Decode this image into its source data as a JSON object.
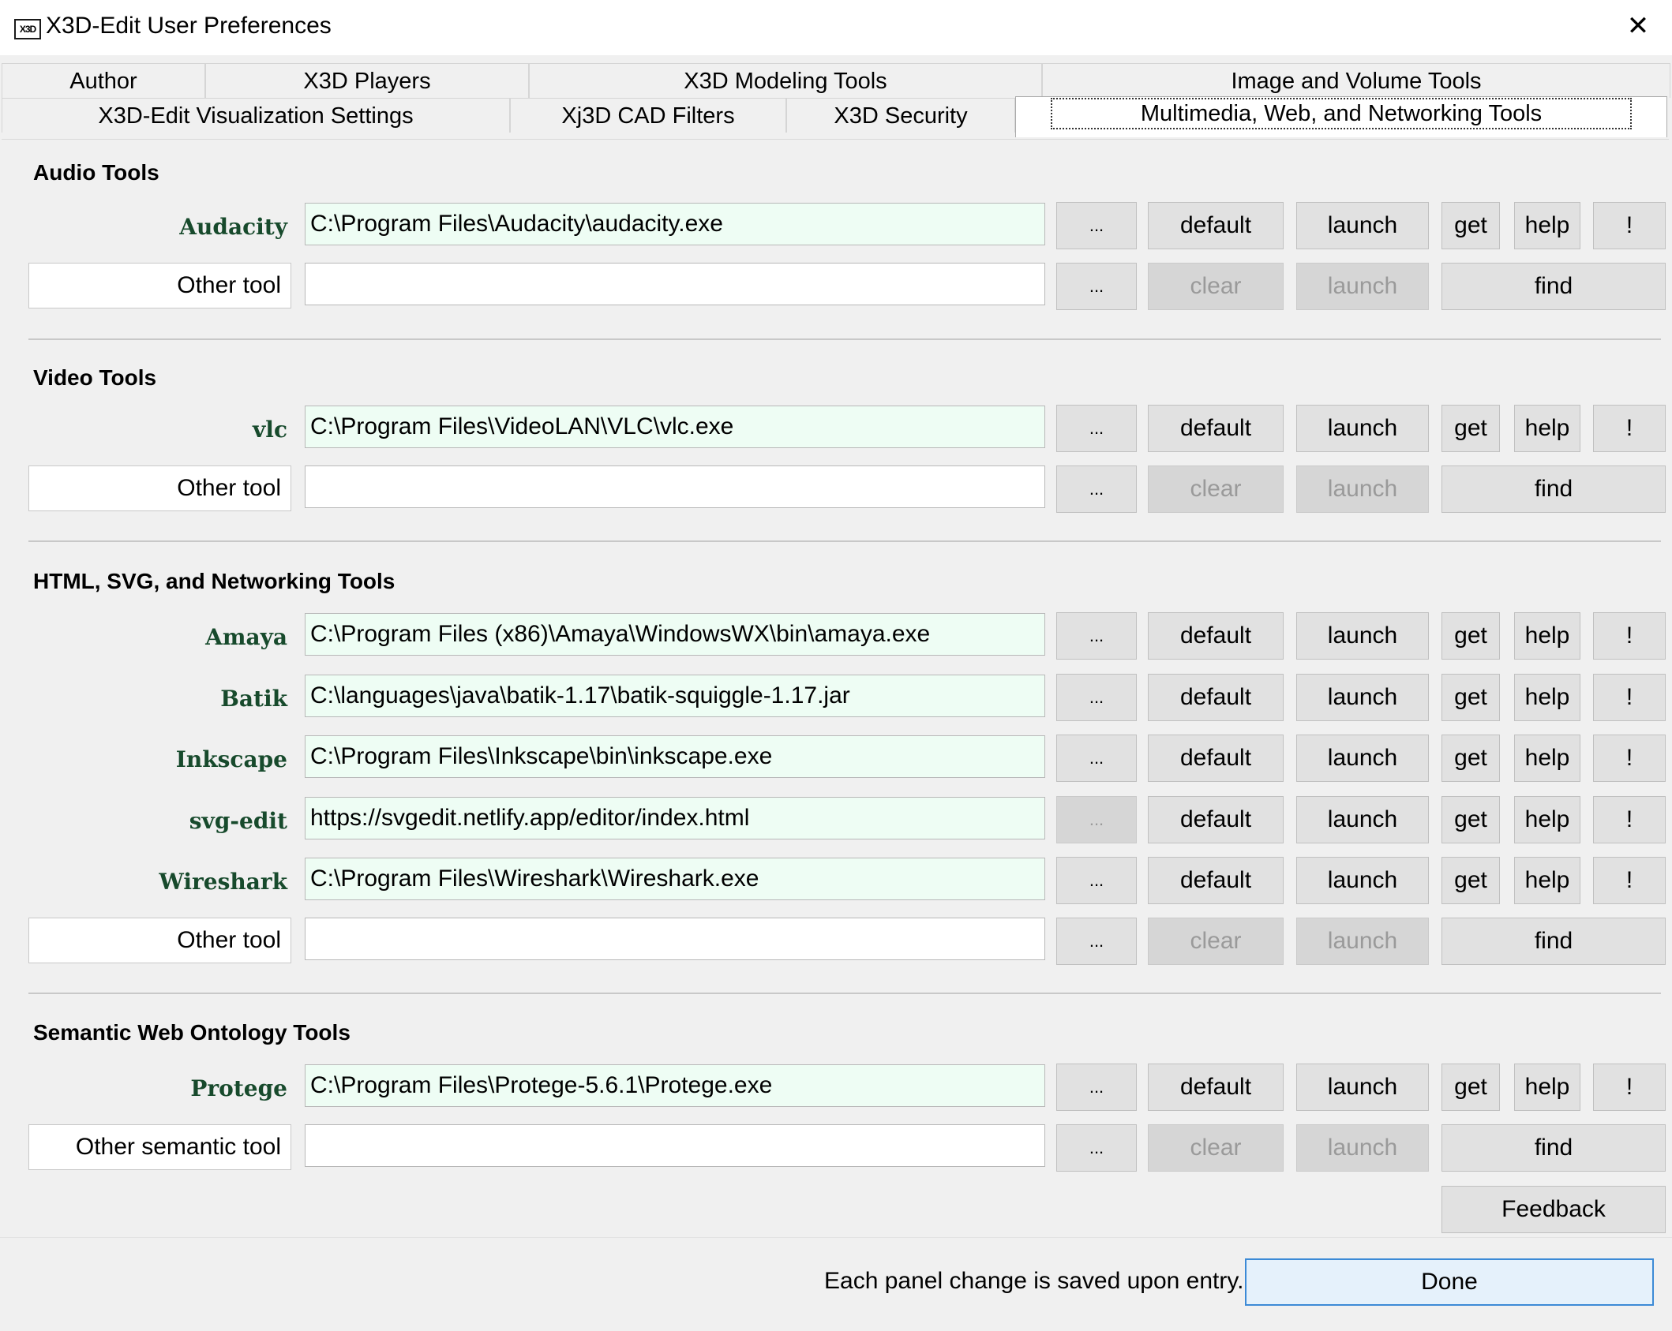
{
  "window": {
    "title": "X3D-Edit User Preferences",
    "icon_text": "X3D",
    "close_glyph": "✕"
  },
  "tabs": {
    "row1": [
      "Author",
      "X3D Players",
      "X3D Modeling Tools",
      "Image and Volume Tools"
    ],
    "row2": [
      "X3D-Edit Visualization Settings",
      "Xj3D CAD Filters",
      "X3D Security",
      "Multimedia, Web, and Networking Tools"
    ],
    "selected": "Multimedia, Web, and Networking Tools"
  },
  "buttons": {
    "browse": "...",
    "default": "default",
    "launch": "launch",
    "get": "get",
    "help": "help",
    "bang": "!",
    "clear": "clear",
    "find": "find",
    "feedback": "Feedback"
  },
  "sections": {
    "audio": {
      "title": "Audio Tools",
      "tools": [
        {
          "name": "Audacity",
          "path": "C:\\Program Files\\Audacity\\audacity.exe"
        }
      ],
      "other_label": "Other tool",
      "other_value": ""
    },
    "video": {
      "title": "Video Tools",
      "tools": [
        {
          "name": "vlc",
          "path": "C:\\Program Files\\VideoLAN\\VLC\\vlc.exe"
        }
      ],
      "other_label": "Other tool",
      "other_value": ""
    },
    "html": {
      "title": "HTML, SVG, and Networking Tools",
      "tools": [
        {
          "name": "Amaya",
          "path": "C:\\Program Files (x86)\\Amaya\\WindowsWX\\bin\\amaya.exe"
        },
        {
          "name": "Batik",
          "path": "C:\\languages\\java\\batik-1.17\\batik-squiggle-1.17.jar"
        },
        {
          "name": "Inkscape",
          "path": "C:\\Program Files\\Inkscape\\bin\\inkscape.exe"
        },
        {
          "name": "svg-edit",
          "path": "https://svgedit.netlify.app/editor/index.html"
        },
        {
          "name": "Wireshark",
          "path": "C:\\Program Files\\Wireshark\\Wireshark.exe"
        }
      ],
      "other_label": "Other tool",
      "other_value": ""
    },
    "semantic": {
      "title": "Semantic Web Ontology Tools",
      "tools": [
        {
          "name": "Protege",
          "path": "C:\\Program Files\\Protege-5.6.1\\Protege.exe"
        }
      ],
      "other_label": "Other semantic tool",
      "other_value": ""
    }
  },
  "footer": {
    "message": "Each panel change is saved upon entry.",
    "done": "Done"
  }
}
